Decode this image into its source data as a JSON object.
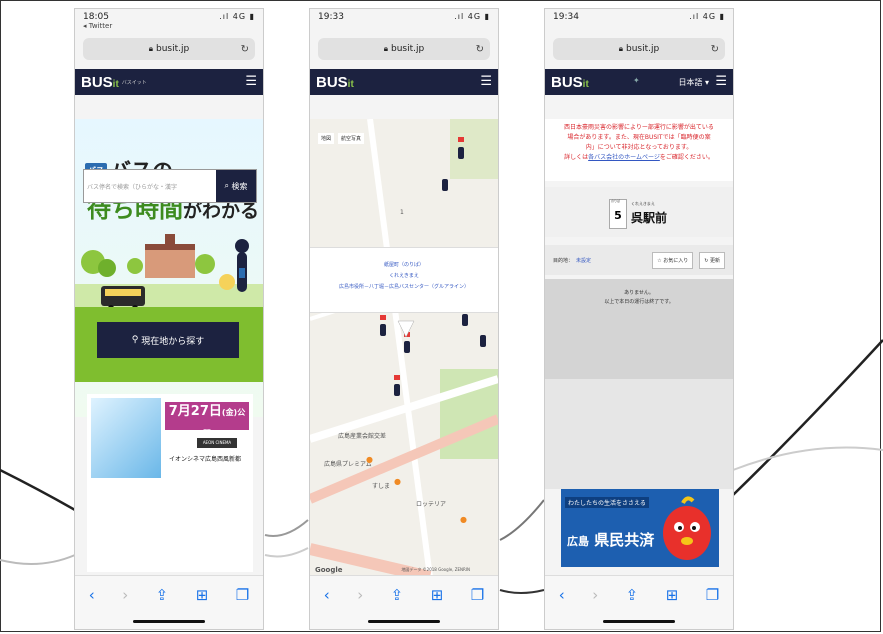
{
  "phones": [
    {
      "time": "18:05",
      "back_link": "◂ Twitter",
      "signal": "4G",
      "url": "busit.jp",
      "logo": "BUS",
      "logo_it": "it",
      "logo_sub": "バスイット",
      "hero_title_badge": "バス",
      "hero_title_line1": "バスの",
      "hero_title_line2a": "待ち時間",
      "hero_title_line2b": "がわかる",
      "search_placeholder": "バス停名で検索（ひらがな・漢字",
      "search_button": "検索",
      "location_button": "現在地から探す",
      "ad_date": "7月27日",
      "ad_date_suffix": "(金)公開",
      "ad_cinema_logo": "AEON CINEMA",
      "ad_cinema_name": "イオンシネマ広島西風新都"
    },
    {
      "time": "19:33",
      "signal": "4G",
      "url": "busit.jp",
      "logo": "BUS",
      "logo_it": "it",
      "map_tab1": "地図",
      "map_tab2": "航空写真",
      "info_line1": "紙屋町（のりば）",
      "info_line2": "くれえきまえ",
      "info_line3": "広島市役所－八丁堀－広島バスセンター（グルアライン）",
      "map_label_1": "1",
      "map_label_2": "広島産業会館交差",
      "map_label_3": "広島県プレミアム",
      "map_label_4": "すしま",
      "map_label_5": "ロッテリア",
      "google": "Google",
      "copyright": "地図データ ©2018 Google, ZENRIN"
    },
    {
      "time": "19:34",
      "signal": "4G",
      "url": "busit.jp",
      "logo": "BUS",
      "logo_it": "it",
      "lang": "日本語",
      "notice_line1": "西日本豪雨災害の影響によりー部運行に影響が出ている",
      "notice_line2": "場合があります。また、現在BUSITでは「臨時便の案",
      "notice_line3": "内」について非対応となっております。",
      "notice_line4_pre": "詳しくは",
      "notice_link": "各バス会社のホームページ",
      "notice_line4_post": "をご確認ください。",
      "stop_number_label": "のりば",
      "stop_number": "5",
      "stop_kana": "くれえきまえ",
      "stop_name": "呉駅前",
      "dest_label": "目的地：",
      "dest_value": "未設定",
      "btn_favorite": "☆ お気に入り",
      "btn_refresh": "↻ 更新",
      "result_line1": "ありません。",
      "result_line2": "以上で本日の運行は終了です。",
      "ad_caption": "わたしたちの生活をささえる",
      "ad_brand_a": "広島",
      "ad_brand_b": "県民共済"
    }
  ]
}
